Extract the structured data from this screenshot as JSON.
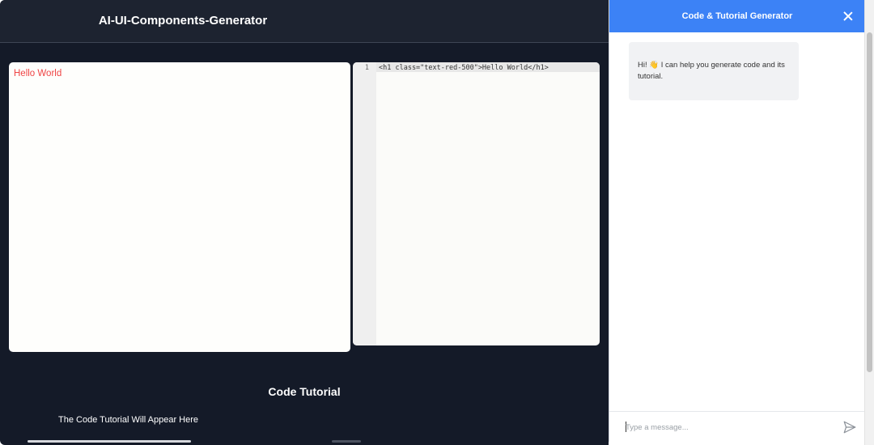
{
  "app": {
    "title": "AI-UI-Components-Generator"
  },
  "preview": {
    "text": "Hello World",
    "text_color": "#ef4444"
  },
  "editor": {
    "line_number": "1",
    "code": "<h1 class=\"text-red-500\">Hello World</h1>"
  },
  "tutorial": {
    "title": "Code Tutorial",
    "placeholder": "The Code Tutorial Will Appear Here"
  },
  "chat": {
    "title": "Code & Tutorial Generator",
    "close_icon": "close-icon",
    "greeting": "Hi! 👋 I can help you generate code and its tutorial.",
    "input_placeholder": "Type a message...",
    "send_icon": "send-icon",
    "accent_color": "#3c82f6"
  }
}
